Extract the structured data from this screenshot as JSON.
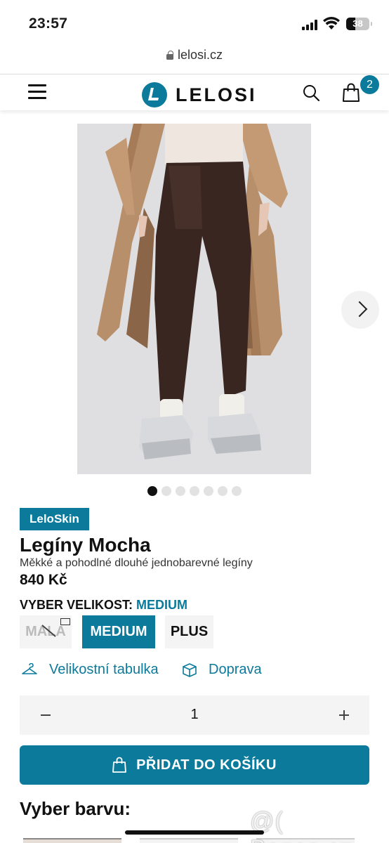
{
  "status_bar": {
    "time": "23:57",
    "battery": "38"
  },
  "browser": {
    "url": "lelosi.cz"
  },
  "header": {
    "logo_text": "LELOSI",
    "cart_count": "2",
    "icons": [
      "menu-icon",
      "search-icon",
      "shopping-bag-icon"
    ]
  },
  "gallery": {
    "dot_count": 7,
    "active_dot": 0,
    "next_icon": "chevron-right-icon"
  },
  "product": {
    "brand": "LeloSkin",
    "title": "Legíny Mocha",
    "subtitle": "Měkké a pohodlné dlouhé jednobarevné legíny",
    "price": "840 Kč"
  },
  "size": {
    "label": "VYBER VELIKOST:",
    "selected": "MEDIUM",
    "options": [
      {
        "label": "MALA",
        "state": "unavailable"
      },
      {
        "label": "MEDIUM",
        "state": "selected"
      },
      {
        "label": "PLUS",
        "state": "available"
      }
    ]
  },
  "links": {
    "size_chart": "Velikostní tabulka",
    "delivery": "Doprava"
  },
  "quantity": {
    "value": "1"
  },
  "cart_button": {
    "label": "PŘIDAT DO KOŠÍKU"
  },
  "colors": {
    "heading": "Vyber barvu:"
  },
  "watermark": {
    "text": "@( Bazos.cz"
  },
  "theme": {
    "accent": "#0b7a9b"
  }
}
